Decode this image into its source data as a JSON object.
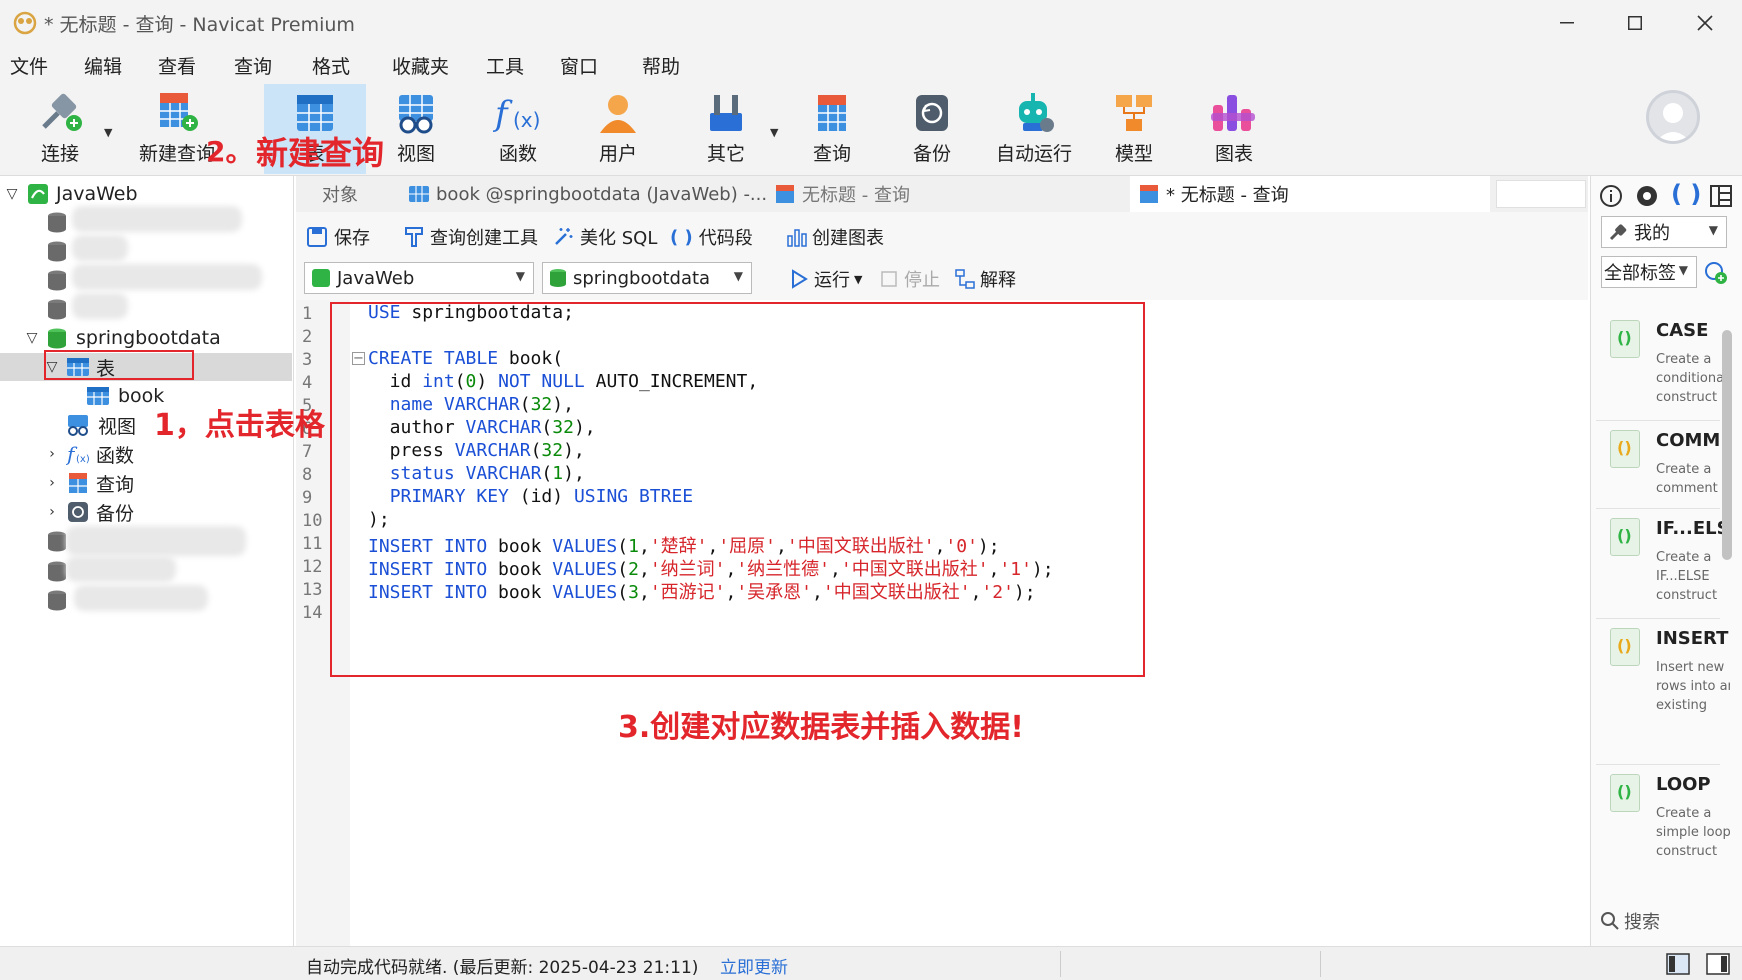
{
  "window": {
    "title": "* 无标题 - 查询 - Navicat Premium"
  },
  "menu": [
    "文件",
    "编辑",
    "查看",
    "查询",
    "格式",
    "收藏夹",
    "工具",
    "窗口",
    "帮助"
  ],
  "toolbar": {
    "connect": "连接",
    "new_query": "新建查询",
    "table": "表",
    "view": "视图",
    "function": "函数",
    "user": "用户",
    "other": "其它",
    "query": "查询",
    "backup": "备份",
    "automation": "自动运行",
    "model": "模型",
    "chart": "图表"
  },
  "sidebar": {
    "connection": "JavaWeb",
    "database": "springbootdata",
    "tables_node": "表",
    "table_book": "book",
    "views_node": "视图",
    "functions_node": "函数",
    "queries_node": "查询",
    "backups_node": "备份"
  },
  "tabs": {
    "objects": "对象",
    "book_tab": "book @springbootdata (JavaWeb) -...",
    "query_tab_1": "无标题 - 查询",
    "query_tab_2": "* 无标题 - 查询"
  },
  "query_toolbar": {
    "save": "保存",
    "query_builder": "查询创建工具",
    "beautify": "美化 SQL",
    "code_snippet": "代码段",
    "create_chart": "创建图表",
    "connection_value": "JavaWeb",
    "database_value": "springbootdata",
    "run": "运行",
    "stop": "停止",
    "explain": "解释"
  },
  "editor": {
    "line_numbers": [
      "1",
      "2",
      "3",
      "4",
      "5",
      "6",
      "7",
      "8",
      "9",
      "10",
      "11",
      "12",
      "13",
      "14"
    ],
    "lines": [
      [
        {
          "t": "USE",
          "c": "kw"
        },
        {
          "t": " springbootdata;",
          "c": "pl"
        }
      ],
      [],
      [
        {
          "t": "CREATE TABLE",
          "c": "kw"
        },
        {
          "t": " book(",
          "c": "pl"
        }
      ],
      [
        {
          "t": "  id ",
          "c": "pl"
        },
        {
          "t": "int",
          "c": "kw"
        },
        {
          "t": "(",
          "c": "pl"
        },
        {
          "t": "0",
          "c": "num"
        },
        {
          "t": ") ",
          "c": "pl"
        },
        {
          "t": "NOT NULL",
          "c": "kw"
        },
        {
          "t": " AUTO_INCREMENT,",
          "c": "pl"
        }
      ],
      [
        {
          "t": "  ",
          "c": "pl"
        },
        {
          "t": "name",
          "c": "kw"
        },
        {
          "t": " ",
          "c": "pl"
        },
        {
          "t": "VARCHAR",
          "c": "kw"
        },
        {
          "t": "(",
          "c": "pl"
        },
        {
          "t": "32",
          "c": "num"
        },
        {
          "t": "),",
          "c": "pl"
        }
      ],
      [
        {
          "t": "  author ",
          "c": "pl"
        },
        {
          "t": "VARCHAR",
          "c": "kw"
        },
        {
          "t": "(",
          "c": "pl"
        },
        {
          "t": "32",
          "c": "num"
        },
        {
          "t": "),",
          "c": "pl"
        }
      ],
      [
        {
          "t": "  press ",
          "c": "pl"
        },
        {
          "t": "VARCHAR",
          "c": "kw"
        },
        {
          "t": "(",
          "c": "pl"
        },
        {
          "t": "32",
          "c": "num"
        },
        {
          "t": "),",
          "c": "pl"
        }
      ],
      [
        {
          "t": "  ",
          "c": "pl"
        },
        {
          "t": "status",
          "c": "kw"
        },
        {
          "t": " ",
          "c": "pl"
        },
        {
          "t": "VARCHAR",
          "c": "kw"
        },
        {
          "t": "(",
          "c": "pl"
        },
        {
          "t": "1",
          "c": "num"
        },
        {
          "t": "),",
          "c": "pl"
        }
      ],
      [
        {
          "t": "  ",
          "c": "pl"
        },
        {
          "t": "PRIMARY KEY",
          "c": "kw"
        },
        {
          "t": " (id) ",
          "c": "pl"
        },
        {
          "t": "USING BTREE",
          "c": "kw"
        }
      ],
      [
        {
          "t": ");",
          "c": "pl"
        }
      ],
      [
        {
          "t": "INSERT INTO",
          "c": "kw"
        },
        {
          "t": " book ",
          "c": "pl"
        },
        {
          "t": "VALUES",
          "c": "kw"
        },
        {
          "t": "(",
          "c": "pl"
        },
        {
          "t": "1",
          "c": "num"
        },
        {
          "t": ",",
          "c": "pl"
        },
        {
          "t": "'楚辞'",
          "c": "str"
        },
        {
          "t": ",",
          "c": "pl"
        },
        {
          "t": "'屈原'",
          "c": "str"
        },
        {
          "t": ",",
          "c": "pl"
        },
        {
          "t": "'中国文联出版社'",
          "c": "str"
        },
        {
          "t": ",",
          "c": "pl"
        },
        {
          "t": "'0'",
          "c": "str"
        },
        {
          "t": ");",
          "c": "pl"
        }
      ],
      [
        {
          "t": "INSERT INTO",
          "c": "kw"
        },
        {
          "t": " book ",
          "c": "pl"
        },
        {
          "t": "VALUES",
          "c": "kw"
        },
        {
          "t": "(",
          "c": "pl"
        },
        {
          "t": "2",
          "c": "num"
        },
        {
          "t": ",",
          "c": "pl"
        },
        {
          "t": "'纳兰词'",
          "c": "str"
        },
        {
          "t": ",",
          "c": "pl"
        },
        {
          "t": "'纳兰性德'",
          "c": "str"
        },
        {
          "t": ",",
          "c": "pl"
        },
        {
          "t": "'中国文联出版社'",
          "c": "str"
        },
        {
          "t": ",",
          "c": "pl"
        },
        {
          "t": "'1'",
          "c": "str"
        },
        {
          "t": ");",
          "c": "pl"
        }
      ],
      [
        {
          "t": "INSERT INTO",
          "c": "kw"
        },
        {
          "t": " book ",
          "c": "pl"
        },
        {
          "t": "VALUES",
          "c": "kw"
        },
        {
          "t": "(",
          "c": "pl"
        },
        {
          "t": "3",
          "c": "num"
        },
        {
          "t": ",",
          "c": "pl"
        },
        {
          "t": "'西游记'",
          "c": "str"
        },
        {
          "t": ",",
          "c": "pl"
        },
        {
          "t": "'吴承恩'",
          "c": "str"
        },
        {
          "t": ",",
          "c": "pl"
        },
        {
          "t": "'中国文联出版社'",
          "c": "str"
        },
        {
          "t": ",",
          "c": "pl"
        },
        {
          "t": "'2'",
          "c": "str"
        },
        {
          "t": ");",
          "c": "pl"
        }
      ],
      []
    ]
  },
  "right_panel": {
    "dropdown_1": "我的",
    "dropdown_2": "全部标签",
    "snippets": [
      {
        "title": "CASE",
        "desc": "Create a conditional construct"
      },
      {
        "title": "COMMENT",
        "desc": "Create a comment"
      },
      {
        "title": "IF...ELSE",
        "desc": "Create a IF...ELSE construct"
      },
      {
        "title": "INSERT",
        "desc": "Insert new rows into an existing table"
      },
      {
        "title": "LOOP",
        "desc": "Create a simple loop construct"
      }
    ],
    "search_placeholder": "搜索"
  },
  "statusbar": {
    "text": "自动完成代码就绪. (最后更新: 2025-04-23 21:11)",
    "link": "立即更新"
  },
  "annotations": {
    "step1": "1，点击表格",
    "step2_prefix": "2。",
    "step2_text": "新建查询",
    "step3": "3.创建对应数据表并插入数据!"
  },
  "colors": {
    "annotation_red": "#e3262b",
    "keyword_blue": "#1a4fd6",
    "string_red": "#d6262b",
    "number_green": "#0a8a0a",
    "selected_tool_bg": "#cce4f7"
  }
}
